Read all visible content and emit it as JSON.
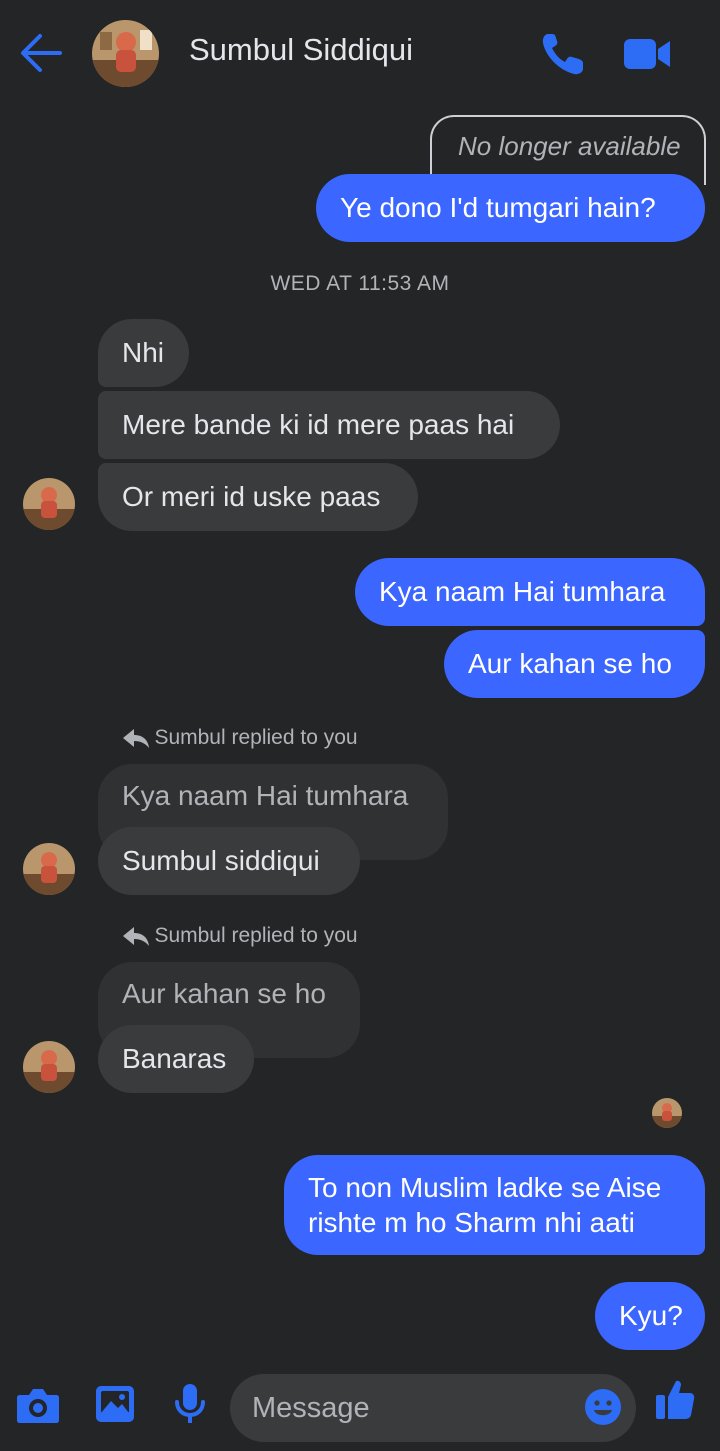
{
  "header": {
    "contact_name": "Sumbul Siddiqui",
    "icons": [
      "back-arrow-icon",
      "phone-icon",
      "video-camera-icon"
    ]
  },
  "messages": {
    "unavailable_note": "No longer available",
    "m1": "Ye dono I'd  tumgari hain?",
    "timestamp": "WED AT 11:53 AM",
    "m2": "Nhi",
    "m3": "Mere bande ki id mere paas hai",
    "m4": "Or meri id uske paas",
    "m5": "Kya naam Hai tumhara",
    "m6": "Aur kahan se ho",
    "reply1_label": "Sumbul replied to you",
    "reply1_quote": "Kya naam Hai tumhara",
    "m7": "Sumbul siddiqui",
    "reply2_label": "Sumbul replied to you",
    "reply2_quote": "Aur kahan se ho",
    "m8": "Banaras",
    "m9_line1": "To non Muslim ladke se Aise",
    "m9_line2": "rishte m ho Sharm nhi aati",
    "m10": "Kyu?"
  },
  "composer": {
    "placeholder": "Message",
    "icons": [
      "camera-icon",
      "gallery-icon",
      "microphone-icon",
      "emoji-icon",
      "like-icon"
    ]
  },
  "colors": {
    "background": "#242526",
    "accent": "#3b66ff",
    "incoming_bubble": "#3a3b3c",
    "icon_blue": "#2d6cf5"
  }
}
